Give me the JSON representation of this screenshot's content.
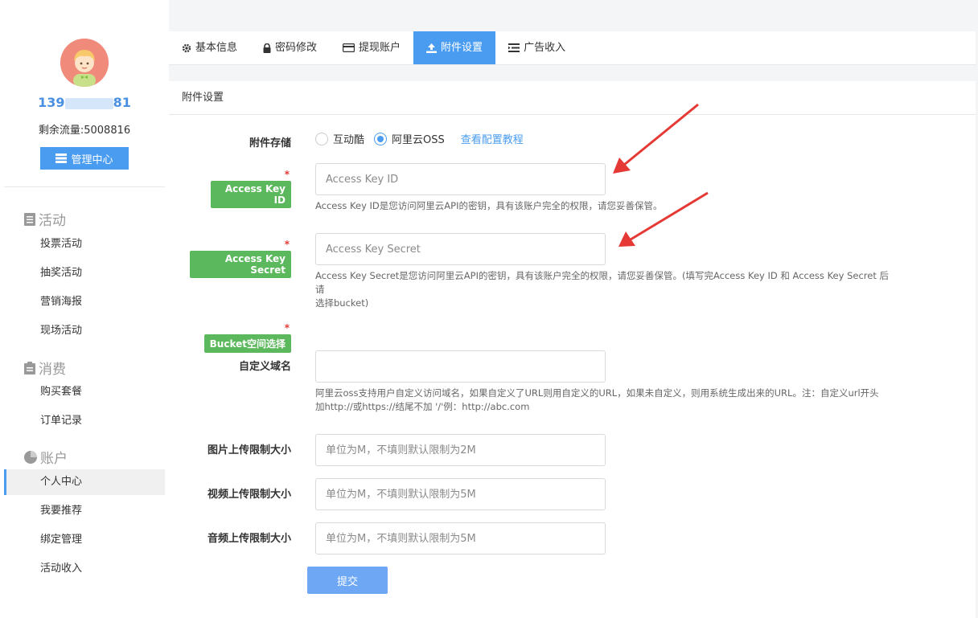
{
  "user": {
    "phone_prefix": "139",
    "phone_suffix": "81",
    "traffic_label": "剩余流量:",
    "traffic_value": "5008816"
  },
  "sidebar": {
    "admin_button": "管理中心",
    "sections": [
      {
        "title": "活动",
        "icon": "document-icon",
        "items": [
          "投票活动",
          "抽奖活动",
          "营销海报",
          "现场活动"
        ]
      },
      {
        "title": "消费",
        "icon": "clipboard-icon",
        "items": [
          "购买套餐",
          "订单记录"
        ]
      },
      {
        "title": "账户",
        "icon": "pie-chart-icon",
        "items": [
          "个人中心",
          "我要推荐",
          "绑定管理",
          "活动收入"
        ]
      }
    ],
    "active_item": "个人中心"
  },
  "tabs": [
    {
      "label": "基本信息",
      "icon": "gear-icon"
    },
    {
      "label": "密码修改",
      "icon": "lock-icon"
    },
    {
      "label": "提现账户",
      "icon": "card-icon"
    },
    {
      "label": "附件设置",
      "icon": "upload-icon"
    },
    {
      "label": "广告收入",
      "icon": "list-icon"
    }
  ],
  "active_tab": "附件设置",
  "panel": {
    "title": "附件设置",
    "storage": {
      "label": "附件存储",
      "options": [
        "互动酷",
        "阿里云OSS"
      ],
      "selected": "阿里云OSS",
      "tutorial_link": "查看配置教程"
    },
    "access_key_id": {
      "label": "Access Key ID",
      "placeholder": "Access Key ID",
      "help": "Access Key ID是您访问阿里云API的密钥，具有该账户完全的权限，请您妥善保管。"
    },
    "access_key_secret": {
      "label": "Access Key Secret",
      "placeholder": "Access Key Secret",
      "help_line1": "Access Key Secret是您访问阿里云API的密钥，具有该账户完全的权限，请您妥善保管。(填写完Access Key ID 和 Access Key Secret 后请",
      "help_line2": "选择bucket)"
    },
    "bucket": {
      "label": "Bucket空间选择"
    },
    "custom_domain": {
      "label": "自定义域名",
      "placeholder": "",
      "help_line1": "阿里云oss支持用户自定义访问域名，如果自定义了URL则用自定义的URL，如果未自定义，则用系统生成出来的URL。注：自定义url开头",
      "help_line2": "加http://或https://结尾不加 '/'例：http://abc.com"
    },
    "image_limit": {
      "label": "图片上传限制大小",
      "placeholder": "单位为M，不填则默认限制为2M"
    },
    "video_limit": {
      "label": "视频上传限制大小",
      "placeholder": "单位为M，不填则默认限制为5M"
    },
    "audio_limit": {
      "label": "音频上传限制大小",
      "placeholder": "单位为M，不填则默认限制为5M"
    },
    "submit": "提交"
  },
  "colors": {
    "accent": "#4a9cf0",
    "tag_green": "#5cb85c",
    "arrow_red": "#e53935"
  }
}
